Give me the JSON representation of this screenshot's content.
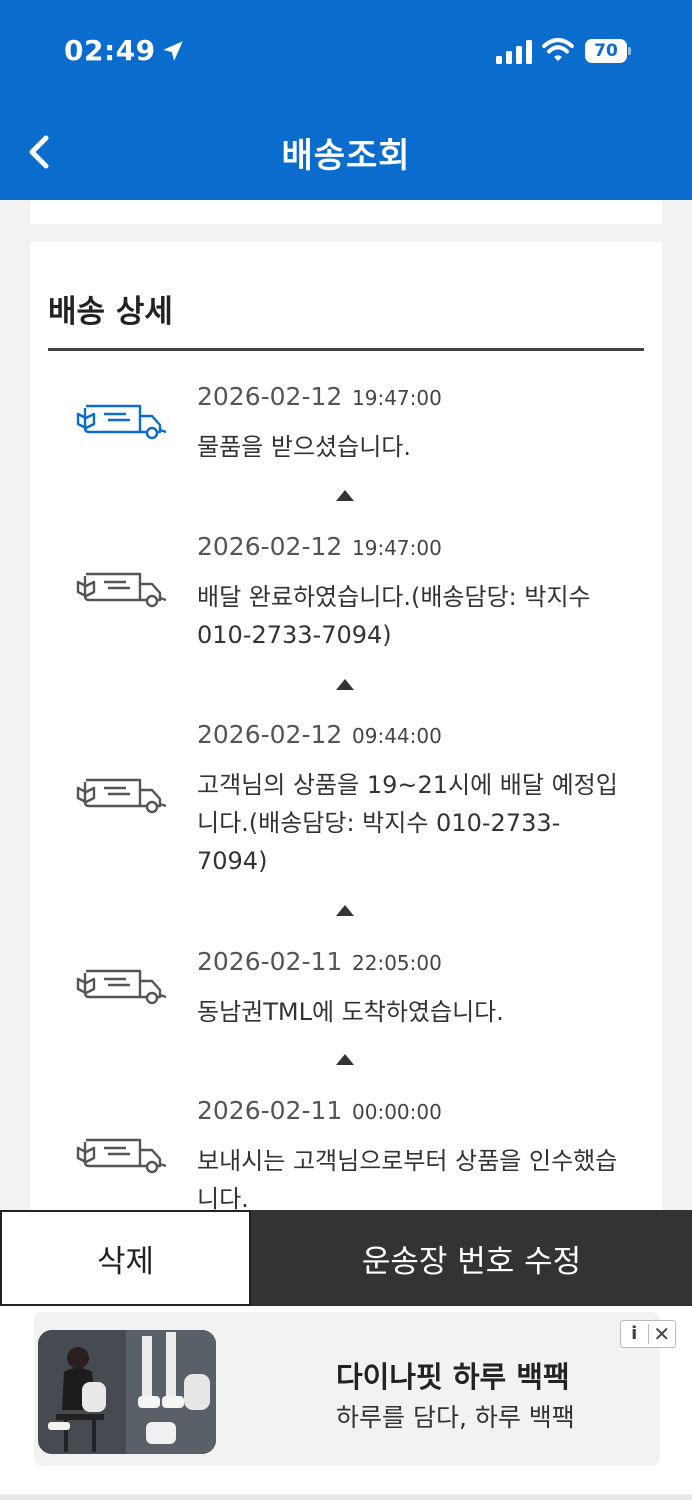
{
  "status_bar": {
    "time": "02:49",
    "battery": "70"
  },
  "header": {
    "title": "배송조회",
    "back_icon": "chevron-left-icon",
    "color": "#0a6ccc"
  },
  "detail": {
    "section_title": "배송 상세",
    "events": [
      {
        "date": "2026-02-12",
        "time": "19:47:00",
        "desc": "물품을 받으셨습니다.",
        "icon": "truck-icon",
        "active": true
      },
      {
        "date": "2026-02-12",
        "time": "19:47:00",
        "desc": "배달 완료하였습니다.(배송담당: 박지수 010-2733-7094)",
        "icon": "truck-icon",
        "active": false
      },
      {
        "date": "2026-02-12",
        "time": "09:44:00",
        "desc": "고객님의 상품을 19~21시에 배달 예정입니다.(배송담당: 박지수 010-2733-7094)",
        "icon": "truck-icon",
        "active": false
      },
      {
        "date": "2026-02-11",
        "time": "22:05:00",
        "desc": "동남권TML에 도착하였습니다.",
        "icon": "truck-icon",
        "active": false
      },
      {
        "date": "2026-02-11",
        "time": "00:00:00",
        "desc": "보내시는 고객님으로부터 상품을 인수했습니다.",
        "icon": "truck-icon",
        "active": false
      }
    ]
  },
  "actions": {
    "delete_label": "삭제",
    "edit_label": "운송장 번호 수정"
  },
  "ad": {
    "title": "다이나핏 하루 백팩",
    "subtitle": "하루를 담다, 하루 백팩",
    "info_label": "i",
    "close_label": "✕"
  }
}
